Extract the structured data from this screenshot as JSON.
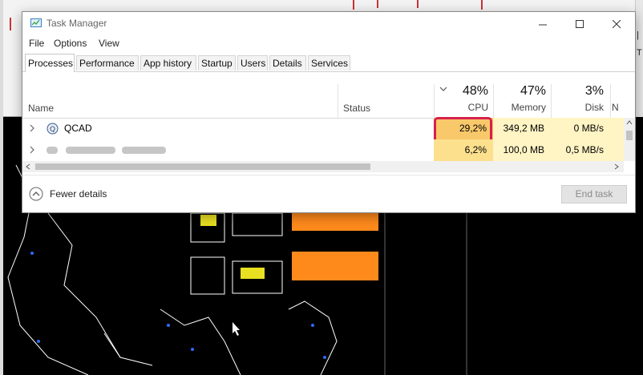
{
  "window": {
    "title": "Task Manager"
  },
  "menu": [
    "File",
    "Options",
    "View"
  ],
  "tabs": [
    "Processes",
    "Performance",
    "App history",
    "Startup",
    "Users",
    "Details",
    "Services"
  ],
  "columns": {
    "name": "Name",
    "status": "Status",
    "cpu": {
      "percent": "48%",
      "label": "CPU"
    },
    "memory": {
      "percent": "47%",
      "label": "Memory"
    },
    "disk": {
      "percent": "3%",
      "label": "Disk"
    },
    "network": {
      "label": "N"
    }
  },
  "rows": [
    {
      "name": "QCAD",
      "cpu": "29,2%",
      "memory": "349,2 MB",
      "disk": "0 MB/s"
    },
    {
      "name": "",
      "cpu": "6,2%",
      "memory": "100,0 MB",
      "disk": "0,5 MB/s"
    }
  ],
  "footer": {
    "fewer_details": "Fewer details",
    "end_task": "End task"
  },
  "colors": {
    "highlight_border": "#d6204c",
    "cpu_cell_hot": "#f8c86a",
    "cpu_cell_warm": "#fde08e",
    "heat_light": "#fff4c4"
  }
}
